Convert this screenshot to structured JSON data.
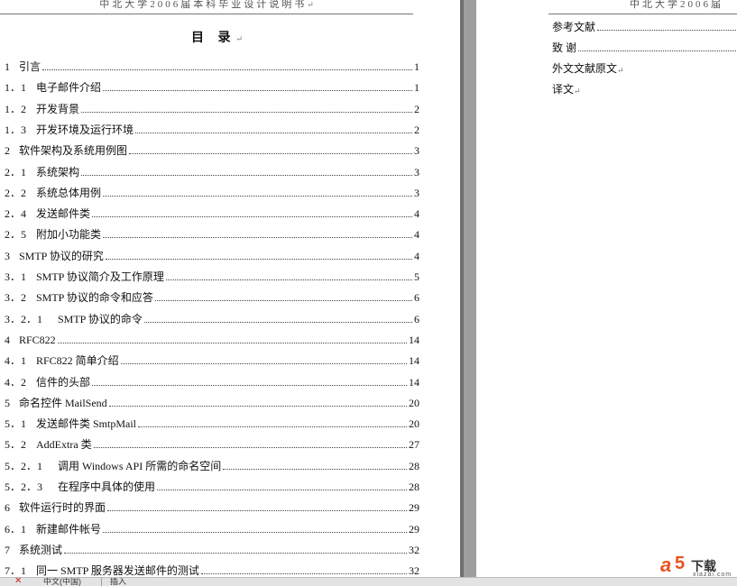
{
  "header": {
    "left": "中北大学2006届本科毕业设计说明书",
    "right": "中北大学2006届",
    "mark": "↵"
  },
  "toc": {
    "title": "目 录",
    "title_mark": "↵",
    "rows": [
      {
        "num": "1",
        "title": "引言",
        "page": "1"
      },
      {
        "num": "1．1",
        "title": "电子邮件介绍",
        "page": "1"
      },
      {
        "num": "1．2",
        "title": "开发背景",
        "page": "2"
      },
      {
        "num": "1．3",
        "title": "开发环境及运行环境",
        "page": "2"
      },
      {
        "num": "2",
        "title": "软件架构及系统用例图",
        "page": "3"
      },
      {
        "num": "2．1",
        "title": "系统架构",
        "page": "3"
      },
      {
        "num": "2．2",
        "title": "系统总体用例",
        "page": "3"
      },
      {
        "num": "2．4",
        "title": "发送邮件类",
        "page": "4"
      },
      {
        "num": "2．5",
        "title": "附加小功能类",
        "page": "4"
      },
      {
        "num": "3",
        "title": "SMTP 协议的研究",
        "page": "4"
      },
      {
        "num": "3．1",
        "title": "SMTP 协议简介及工作原理",
        "page": "5"
      },
      {
        "num": "3．2",
        "title": "SMTP 协议的命令和应答",
        "page": "6"
      },
      {
        "num": "3．2．1",
        "title": "SMTP 协议的命令",
        "page": "6"
      },
      {
        "num": "4",
        "title": "RFC822",
        "page": "14"
      },
      {
        "num": "4．1",
        "title": "RFC822 简单介绍",
        "page": "14"
      },
      {
        "num": "4．2",
        "title": "信件的头部",
        "page": "14"
      },
      {
        "num": "5",
        "title": "命名控件 MailSend",
        "page": "20"
      },
      {
        "num": "5．1",
        "title": "发送邮件类 SmtpMail",
        "page": "20"
      },
      {
        "num": "5．2",
        "title": "AddExtra 类",
        "page": "27"
      },
      {
        "num": "5．2．1",
        "title": "调用 Windows API 所需的命名空间",
        "page": "28"
      },
      {
        "num": "5．2．3",
        "title": "在程序中具体的使用",
        "page": "28"
      },
      {
        "num": "6",
        "title": "软件运行时的界面",
        "page": "29"
      },
      {
        "num": "6．1",
        "title": "新建邮件帐号",
        "page": "29"
      },
      {
        "num": "7",
        "title": "系统测试",
        "page": "32"
      },
      {
        "num": "7．1",
        "title": "同一 SMTP 服务器发送邮件的测试",
        "page": "32"
      }
    ]
  },
  "right_page": {
    "rows": [
      {
        "title": "参考文献",
        "leader": true
      },
      {
        "title": "致 谢",
        "leader": true
      },
      {
        "title": "外文文献原文",
        "leader": false
      },
      {
        "title": "译文",
        "leader": false
      }
    ]
  },
  "statusbar": {
    "language": "中文(中国)",
    "mode": "插入"
  },
  "watermark": {
    "logo_a": "a",
    "logo_5": "5",
    "text": "下载",
    "url": "xiazai.com"
  },
  "colors": {
    "workspace": "#9e9e9e",
    "page": "#ffffff",
    "watermark": "#e8541e"
  }
}
